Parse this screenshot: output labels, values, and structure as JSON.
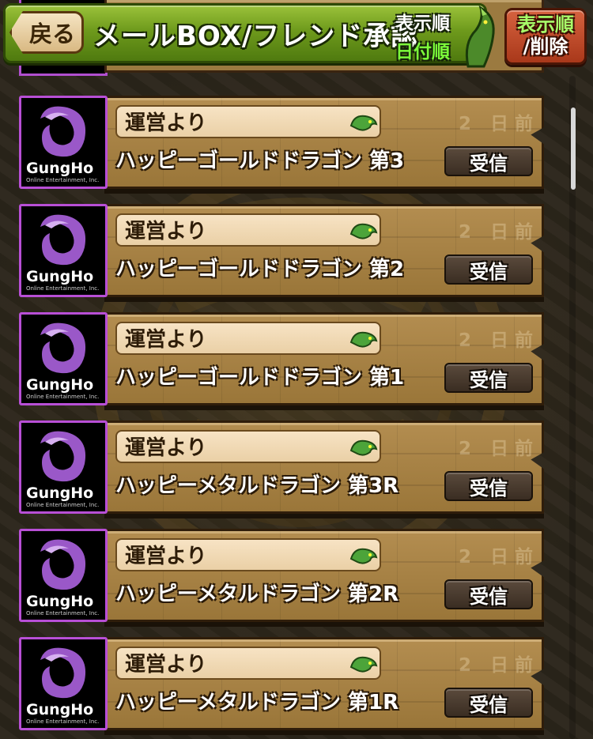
{
  "header": {
    "back_label": "戻る",
    "title": "メールBOX/フレンド承認",
    "sort_label": "表示順",
    "sort_value": "日付順",
    "sort_delete_line1": "表示順",
    "sort_delete_line2": "/削除"
  },
  "mail": {
    "items": [
      {
        "sender": "運営より",
        "subject": "ハッピーゴールドドラゴン 第3",
        "days": "2 日前",
        "receive": "受信"
      },
      {
        "sender": "運営より",
        "subject": "ハッピーゴールドドラゴン 第2",
        "days": "2 日前",
        "receive": "受信"
      },
      {
        "sender": "運営より",
        "subject": "ハッピーゴールドドラゴン 第1",
        "days": "2 日前",
        "receive": "受信"
      },
      {
        "sender": "運営より",
        "subject": "ハッピーメタルドラゴン 第3R",
        "days": "2 日前",
        "receive": "受信"
      },
      {
        "sender": "運営より",
        "subject": "ハッピーメタルドラゴン 第2R",
        "days": "2 日前",
        "receive": "受信"
      },
      {
        "sender": "運営より",
        "subject": "ハッピーメタルドラゴン 第1R",
        "days": "2 日前",
        "receive": "受信"
      }
    ],
    "logo_text": "GungHo",
    "logo_subtext": "Online Entertainment, Inc."
  },
  "icons": {
    "avatar": "gungho-logo-icon",
    "sender_badge": "dragon-icon",
    "sort_badge": "dragon-icon"
  },
  "colors": {
    "header_green": "#6e9a1c",
    "sort_value_green": "#7cfc3a",
    "plank_brown": "#9b7a40",
    "avatar_border": "#b84fd6",
    "receive_button": "#3a2d22",
    "sort_delete_button": "#a9381a"
  }
}
